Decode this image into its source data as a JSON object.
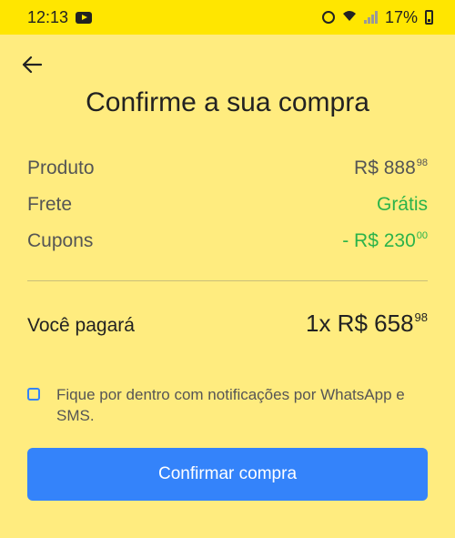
{
  "status_bar": {
    "time": "12:13",
    "battery": "17%"
  },
  "title": "Confirme a sua compra",
  "summary": {
    "product_label": "Produto",
    "product_value": "R$ 888",
    "product_cents": "98",
    "shipping_label": "Frete",
    "shipping_value": "Grátis",
    "coupons_label": "Cupons",
    "coupons_value": "- R$ 230",
    "coupons_cents": "00"
  },
  "total": {
    "label": "Você pagará",
    "value": "1x R$ 658",
    "cents": "98"
  },
  "notifications_opt_in": {
    "text": "Fique por dentro com notificações por WhatsApp e SMS.",
    "checked": false
  },
  "confirm_button_label": "Confirmar compra",
  "colors": {
    "background": "#FFEC7F",
    "status_bar": "#FFE600",
    "primary": "#3483FA",
    "success": "#2BB34A"
  },
  "icons": [
    "youtube-icon",
    "alarm-icon",
    "wifi-icon",
    "signal-icon",
    "battery-icon",
    "arrow-left-icon"
  ]
}
